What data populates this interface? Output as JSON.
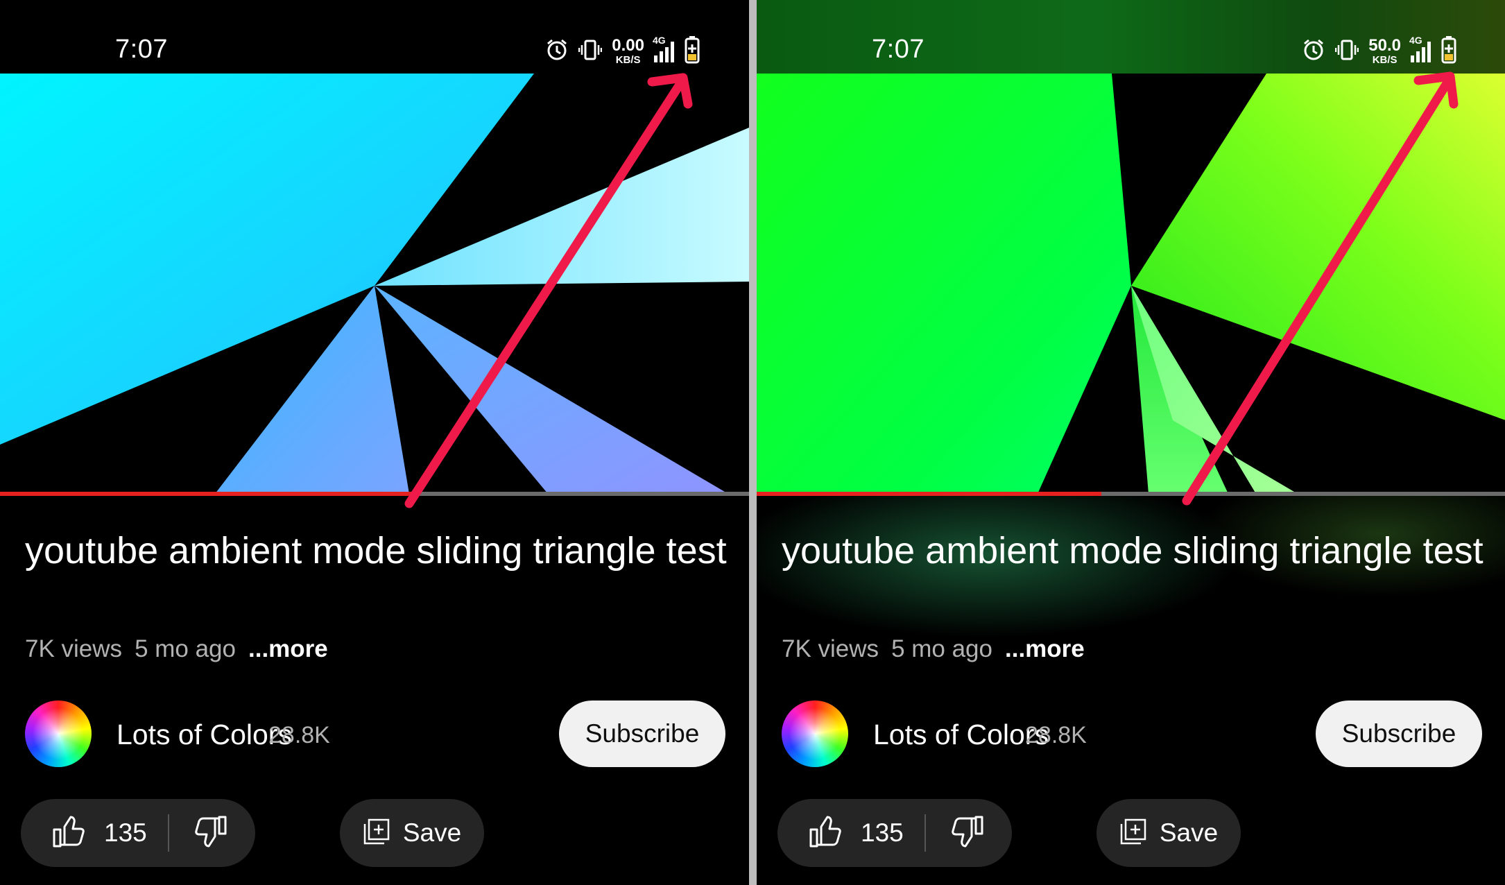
{
  "status": {
    "time": "7:07",
    "left_speed": "0.00",
    "right_speed": "50.0",
    "speed_unit": "KB/S",
    "network": "4G",
    "icons": [
      "alarm-icon",
      "vibrate-icon",
      "signal-icon",
      "battery-charging-icon"
    ]
  },
  "video": {
    "title": "youtube ambient mode sliding triangle test",
    "views": "7K views",
    "age": "5 mo ago",
    "more": "...more",
    "left_progress": 0.55,
    "right_progress": 0.46
  },
  "channel": {
    "name": "Lots of Colors",
    "subscribers": "28.8K",
    "subscribe_label": "Subscribe"
  },
  "actions": {
    "likes": "135",
    "save_label": "Save"
  },
  "colors": {
    "progress": "#e5221f",
    "arrow": "#f01a4a",
    "pill_bg": "#252525",
    "subscribe_bg": "#f1f1f1"
  }
}
